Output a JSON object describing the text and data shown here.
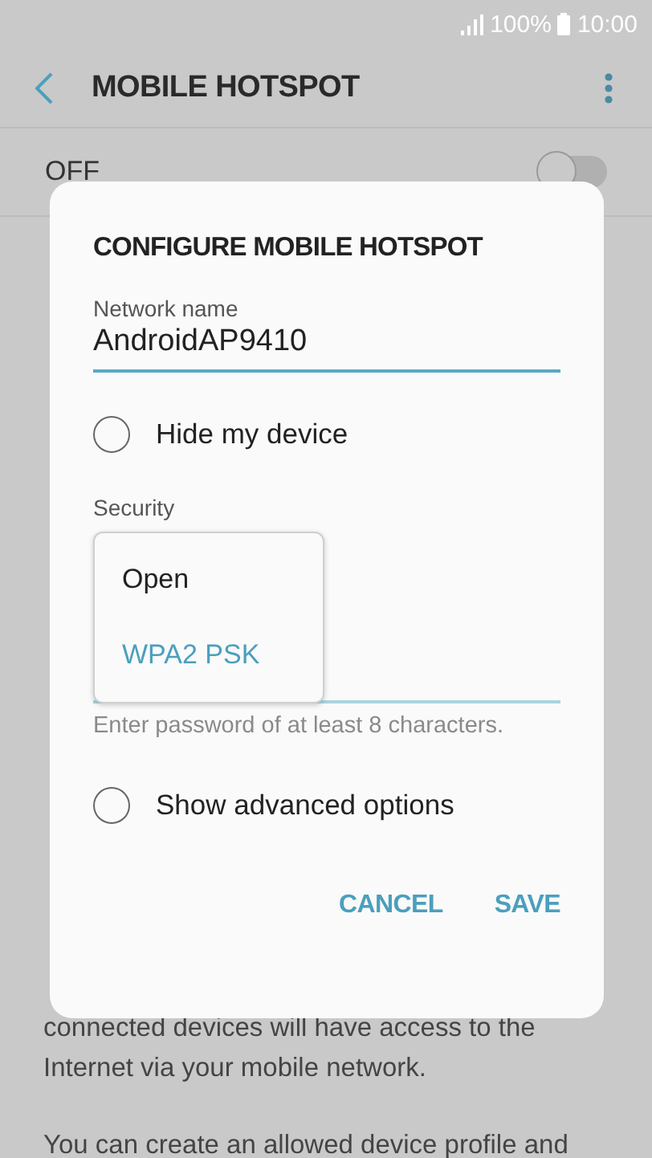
{
  "status_bar": {
    "battery": "100%",
    "time": "10:00"
  },
  "header": {
    "title": "MOBILE HOTSPOT"
  },
  "master_switch": {
    "label": "OFF",
    "on": false
  },
  "description": [
    "connected devices will have access to the Internet via your mobile network.",
    "You can create an allowed device profile and"
  ],
  "dialog": {
    "title": "CONFIGURE MOBILE HOTSPOT",
    "network_name": {
      "label": "Network name",
      "value": "AndroidAP9410"
    },
    "hide_device": {
      "label": "Hide my device",
      "checked": false
    },
    "security": {
      "label": "Security",
      "options": [
        {
          "label": "Open",
          "selected": false
        },
        {
          "label": "WPA2 PSK",
          "selected": true
        }
      ]
    },
    "password_hint": "Enter password of at least 8 characters.",
    "advanced": {
      "label": "Show advanced options",
      "checked": false
    },
    "buttons": [
      "CANCEL",
      "SAVE"
    ]
  }
}
